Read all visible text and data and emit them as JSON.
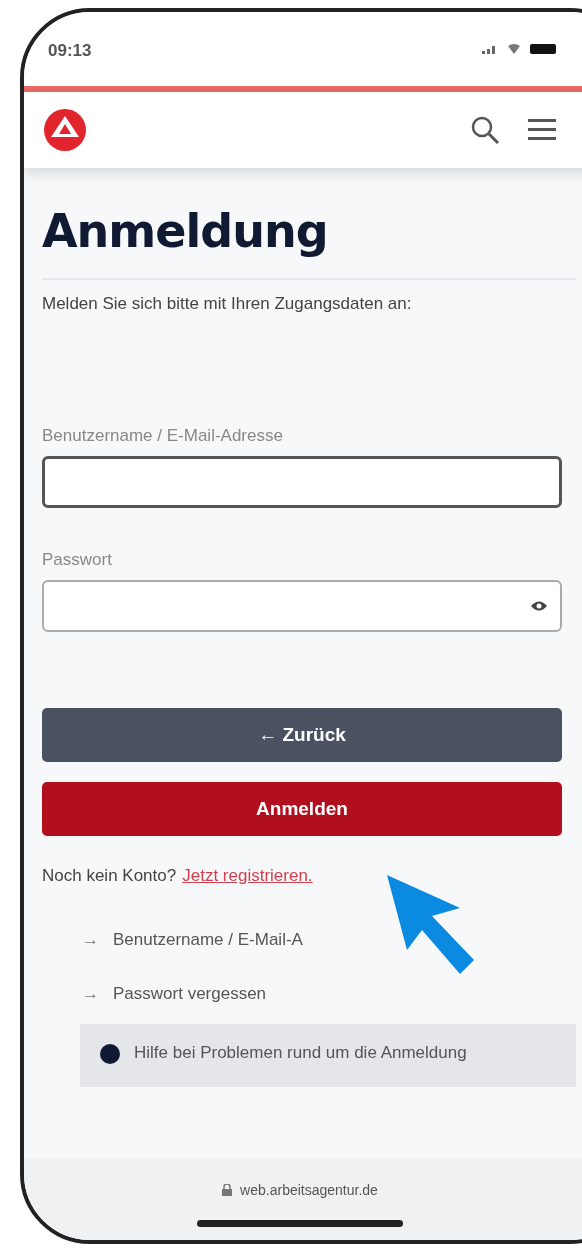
{
  "status_bar": {
    "time": "09:13"
  },
  "page": {
    "title": "Anmeldung",
    "intro": "Melden Sie sich bitte mit Ihren Zugangsdaten an:"
  },
  "fields": [
    {
      "label": "Benutzername / E-Mail-Adresse",
      "focused": true,
      "kind": "text"
    },
    {
      "label": "Passwort",
      "focused": false,
      "kind": "password"
    }
  ],
  "buttons": [
    {
      "label": "Zurück",
      "kind": "secondary",
      "arrow": "←"
    },
    {
      "label": "Anmelden",
      "kind": "primary"
    }
  ],
  "register": {
    "text": "Noch kein Konto?",
    "link": "Jetzt registrieren."
  },
  "links": [
    {
      "arrow": "→",
      "label": "Benutzername / E-Mail-A"
    },
    {
      "arrow": "→",
      "label": "Passwort vergessen"
    }
  ],
  "help": {
    "label": "Hilfe bei Problemen rund um die Anmeldung"
  },
  "browser_bar": {
    "url": "web.arbeitsagentur.de"
  }
}
